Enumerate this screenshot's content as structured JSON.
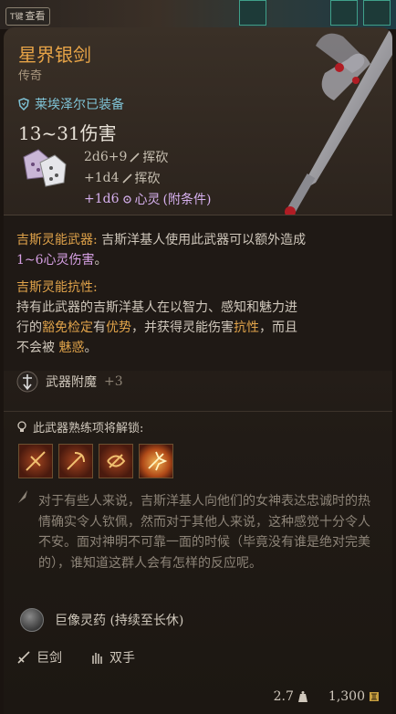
{
  "hotkey": {
    "key": "T键",
    "label": "查看"
  },
  "item": {
    "name": "星界银剑",
    "rarity": "传奇",
    "equipped_by": "莱埃泽尔已装备",
    "damage_total": "13~31伤害",
    "damage_rows": [
      {
        "dice": "2d6+9",
        "type": "挥砍",
        "condition": ""
      },
      {
        "dice": "+1d4",
        "type": "挥砍",
        "condition": ""
      },
      {
        "dice": "+1d6",
        "type": "心灵",
        "condition": "(附条件)"
      }
    ]
  },
  "passives": [
    {
      "title": "吉斯灵能武器:",
      "text": " 吉斯洋基人使用此武器可以额外造成",
      "text2": "1~6心灵伤害",
      "text3": "。"
    },
    {
      "title": "吉斯灵能抗性:",
      "line1": "持有此武器的吉斯洋基人在以智力、感知和魅力进",
      "line2_a": "行的",
      "line2_b": "豁免检定",
      "line2_c": "有",
      "line2_d": "优势",
      "line2_e": "，并获得灵能伤害",
      "line2_f": "抗性",
      "line2_g": "，而且",
      "line3_a": "不会被 ",
      "line3_b": "魅惑",
      "line3_c": "。"
    }
  ],
  "enchantment": {
    "label": "武器附魔",
    "value": "+3"
  },
  "proficiency_unlock": "此武器熟练项将解锁:",
  "skills": [
    "skill-1",
    "skill-2",
    "skill-3",
    "skill-4"
  ],
  "lore": "对于有些人来说，吉斯洋基人向他们的女神表达忠诚时的热情确实令人钦佩，然而对于其他人来说，这种感觉十分令人不安。面对神明不可靠一面的时候（毕竟没有谁是绝对完美的），谁知道这群人会有怎样的反应呢。",
  "potion": "巨像灵药 (持续至长休)",
  "properties": {
    "weapon_type": "巨剑",
    "handedness": "双手"
  },
  "footer": {
    "weight": "2.7",
    "value": "1,300"
  },
  "colors": {
    "title": "#e6a347",
    "equipped": "#7fc3d6",
    "psychic": "#d6b0ee"
  }
}
